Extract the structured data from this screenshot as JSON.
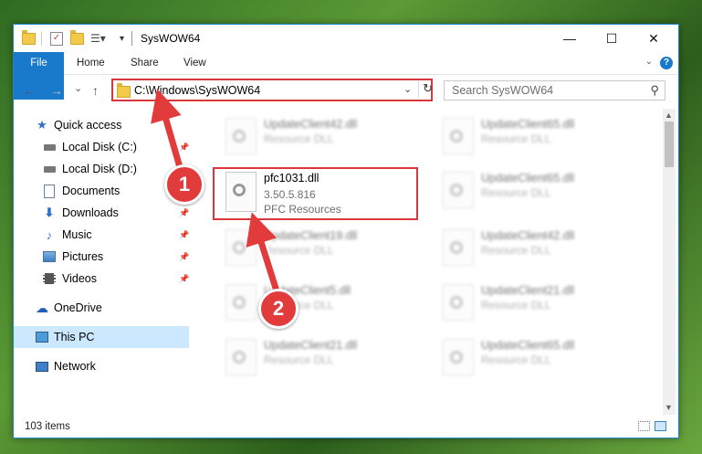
{
  "window": {
    "title": "SysWOW64",
    "controls": {
      "minimize": "—",
      "maximize": "☐",
      "close": "✕"
    }
  },
  "ribbon": {
    "tabs": [
      "File",
      "Home",
      "Share",
      "View"
    ],
    "help": "?"
  },
  "nav": {
    "back": "←",
    "forward": "→",
    "recent": "⌄",
    "up": "↑",
    "address": "C:\\Windows\\SysWOW64",
    "search_placeholder": "Search SysWOW64"
  },
  "sidebar": {
    "items": [
      {
        "label": "Quick access",
        "icon": "star-icon",
        "pinned": false
      },
      {
        "label": "Local Disk (C:)",
        "icon": "drive-icon",
        "pinned": true
      },
      {
        "label": "Local Disk (D:)",
        "icon": "drive-icon",
        "pinned": false
      },
      {
        "label": "Documents",
        "icon": "documents-icon",
        "pinned": true
      },
      {
        "label": "Downloads",
        "icon": "downloads-icon",
        "pinned": true
      },
      {
        "label": "Music",
        "icon": "music-icon",
        "pinned": true
      },
      {
        "label": "Pictures",
        "icon": "pictures-icon",
        "pinned": true
      },
      {
        "label": "Videos",
        "icon": "videos-icon",
        "pinned": true
      },
      {
        "label": "OneDrive",
        "icon": "cloud-icon",
        "pinned": false
      },
      {
        "label": "This PC",
        "icon": "computer-icon",
        "pinned": false,
        "selected": true
      },
      {
        "label": "Network",
        "icon": "network-icon",
        "pinned": false
      }
    ]
  },
  "files": [
    {
      "name": "UpdateClient42.dll",
      "sub1": "Resource DLL",
      "sub2": "",
      "blurred": true
    },
    {
      "name": "UpdateClient65.dll",
      "sub1": "Resource DLL",
      "sub2": "",
      "blurred": true
    },
    {
      "name": "pfc1031.dll",
      "sub1": "3.50.5.816",
      "sub2": "PFC Resources",
      "blurred": false
    },
    {
      "name": "UpdateClient65.dll",
      "sub1": "Resource DLL",
      "sub2": "",
      "blurred": true
    },
    {
      "name": "UpdateClient19.dll",
      "sub1": "Resource DLL",
      "sub2": "",
      "blurred": true
    },
    {
      "name": "UpdateClient42.dll",
      "sub1": "Resource DLL",
      "sub2": "",
      "blurred": true
    },
    {
      "name": "UpdateClient5.dll",
      "sub1": "Resource DLL",
      "sub2": "",
      "blurred": true
    },
    {
      "name": "UpdateClient21.dll",
      "sub1": "Resource DLL",
      "sub2": "",
      "blurred": true
    },
    {
      "name": "UpdateClient21.dll",
      "sub1": "Resource DLL",
      "sub2": "",
      "blurred": true
    },
    {
      "name": "UpdateClient65.dll",
      "sub1": "Resource DLL",
      "sub2": "",
      "blurred": true
    }
  ],
  "status": {
    "count": "103 items"
  },
  "annotations": {
    "step1": "1",
    "step2": "2"
  },
  "colors": {
    "accent": "#1979ca",
    "highlight": "#d9363e",
    "badge": "#e23b3b"
  }
}
